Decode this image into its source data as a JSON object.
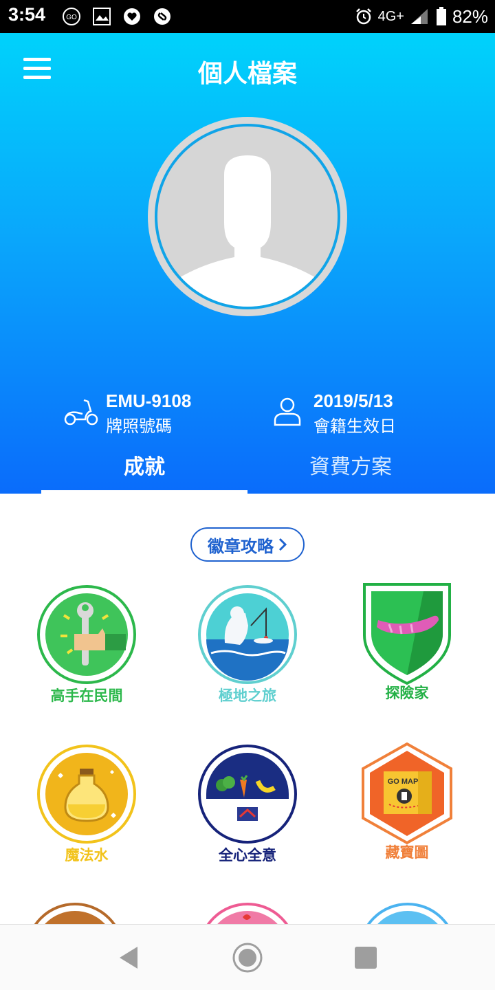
{
  "status_bar": {
    "time": "3:54",
    "network": "4G+",
    "battery": "82%"
  },
  "header": {
    "title": "個人檔案",
    "plate_number": "EMU-9108",
    "plate_label": "牌照號碼",
    "member_date": "2019/5/13",
    "member_label": "會籍生效日"
  },
  "tabs": [
    {
      "label": "成就",
      "active": true
    },
    {
      "label": "資費方案",
      "active": false
    }
  ],
  "guide_button": {
    "label": "徽章攻略"
  },
  "badges": [
    {
      "label": "高手在民間",
      "color": "#2cb84b"
    },
    {
      "label": "極地之旅",
      "color": "#5fcfcf"
    },
    {
      "label": "探險家",
      "color": "#22b045"
    },
    {
      "label": "魔法水",
      "color": "#f2c31b"
    },
    {
      "label": "全心全意",
      "color": "#16237a"
    },
    {
      "label": "藏寶圖",
      "color": "#f0803a"
    }
  ],
  "badge_art_text": {
    "treasure_map": "GO MAP"
  },
  "colors": {
    "header_top": "#00d2fb",
    "header_bottom": "#0a6cfb",
    "accent": "#1f62cf"
  }
}
